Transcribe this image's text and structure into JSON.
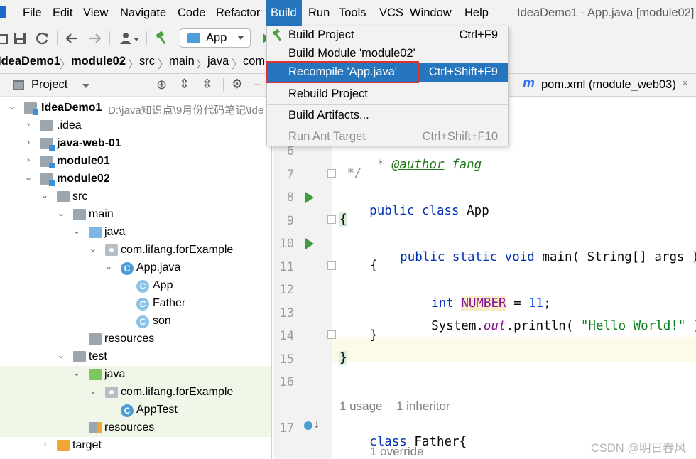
{
  "menubar": {
    "items": [
      "File",
      "Edit",
      "View",
      "Navigate",
      "Code",
      "Refactor",
      "Build",
      "Run",
      "Tools",
      "VCS",
      "Window",
      "Help"
    ],
    "window_title": "IdeaDemo1 - App.java [module02]"
  },
  "toolbar": {
    "run_config": "App"
  },
  "breadcrumb": [
    "IdeaDemo1",
    "module02",
    "src",
    "main",
    "java",
    "com"
  ],
  "project_panel": {
    "title": "Project",
    "tree": [
      {
        "label": "IdeaDemo1",
        "path": "D:\\java知识点\\9月份代码笔记\\Ide"
      },
      {
        "label": ".idea"
      },
      {
        "label": "java-web-01"
      },
      {
        "label": "module01"
      },
      {
        "label": "module02"
      },
      {
        "label": "src"
      },
      {
        "label": "main"
      },
      {
        "label": "java"
      },
      {
        "label": "com.lifang.forExample"
      },
      {
        "label": "App.java"
      },
      {
        "label": "App"
      },
      {
        "label": "Father"
      },
      {
        "label": "son"
      },
      {
        "label": "resources"
      },
      {
        "label": "test"
      },
      {
        "label": "java"
      },
      {
        "label": "com.lifang.forExample"
      },
      {
        "label": "AppTest"
      },
      {
        "label": "resources"
      },
      {
        "label": "target"
      }
    ]
  },
  "editor": {
    "tabs": [
      {
        "label": "pom.xml (module_web03)",
        "icon": "m"
      }
    ],
    "line_numbers": [
      "6",
      "7",
      "8",
      "9",
      "10",
      "11",
      "12",
      "13",
      "14",
      "15",
      "16",
      "17"
    ],
    "code": {
      "l6_star": " * ",
      "l6_tag": "@author",
      "l6_name": " fang",
      "l7": " */",
      "l8_kw": "public class",
      "l8_name": " App",
      "l9": "{",
      "l10_kw": "public static void",
      "l10_rest": " main( String[] args )",
      "l11": "{",
      "l12_kw": "int",
      "l12_const": "NUMBER",
      "l12_eq": " = ",
      "l12_num": "11",
      "l12_semi": ";",
      "l13_a": "System.",
      "l13_out": "out",
      "l13_b": ".println( ",
      "l13_str": "\"Hello World!\"",
      "l13_c": " );",
      "l14": "}",
      "l15": "}",
      "l17_kw": "class",
      "l17_rest": " Father{"
    },
    "hints": {
      "usages": "1 usage",
      "inheritors": "1 inheritor",
      "override": "1 override"
    }
  },
  "build_menu": {
    "items": [
      {
        "label": "Build Project",
        "shortcut": "Ctrl+F9"
      },
      {
        "label": "Build Module 'module02'",
        "shortcut": ""
      },
      {
        "label": "Recompile 'App.java'",
        "shortcut": "Ctrl+Shift+F9"
      },
      {
        "label": "Rebuild Project",
        "shortcut": ""
      },
      {
        "label": "Build Artifacts...",
        "shortcut": ""
      },
      {
        "label": "Run Ant Target",
        "shortcut": "Ctrl+Shift+F10"
      }
    ]
  },
  "watermark": "CSDN @明日春风"
}
